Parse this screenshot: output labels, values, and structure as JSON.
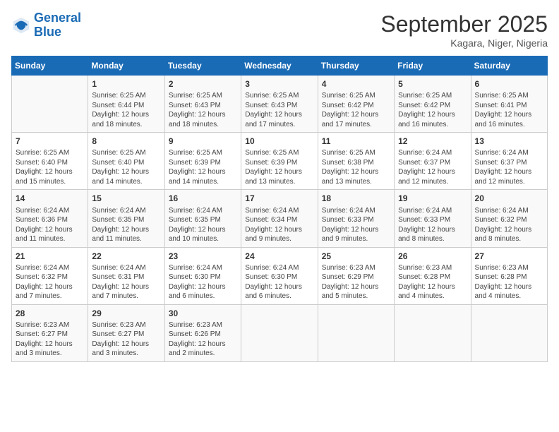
{
  "logo": {
    "line1": "General",
    "line2": "Blue"
  },
  "title": "September 2025",
  "subtitle": "Kagara, Niger, Nigeria",
  "days_of_week": [
    "Sunday",
    "Monday",
    "Tuesday",
    "Wednesday",
    "Thursday",
    "Friday",
    "Saturday"
  ],
  "weeks": [
    [
      {
        "day": "",
        "info": ""
      },
      {
        "day": "1",
        "info": "Sunrise: 6:25 AM\nSunset: 6:44 PM\nDaylight: 12 hours\nand 18 minutes."
      },
      {
        "day": "2",
        "info": "Sunrise: 6:25 AM\nSunset: 6:43 PM\nDaylight: 12 hours\nand 18 minutes."
      },
      {
        "day": "3",
        "info": "Sunrise: 6:25 AM\nSunset: 6:43 PM\nDaylight: 12 hours\nand 17 minutes."
      },
      {
        "day": "4",
        "info": "Sunrise: 6:25 AM\nSunset: 6:42 PM\nDaylight: 12 hours\nand 17 minutes."
      },
      {
        "day": "5",
        "info": "Sunrise: 6:25 AM\nSunset: 6:42 PM\nDaylight: 12 hours\nand 16 minutes."
      },
      {
        "day": "6",
        "info": "Sunrise: 6:25 AM\nSunset: 6:41 PM\nDaylight: 12 hours\nand 16 minutes."
      }
    ],
    [
      {
        "day": "7",
        "info": "Sunrise: 6:25 AM\nSunset: 6:40 PM\nDaylight: 12 hours\nand 15 minutes."
      },
      {
        "day": "8",
        "info": "Sunrise: 6:25 AM\nSunset: 6:40 PM\nDaylight: 12 hours\nand 14 minutes."
      },
      {
        "day": "9",
        "info": "Sunrise: 6:25 AM\nSunset: 6:39 PM\nDaylight: 12 hours\nand 14 minutes."
      },
      {
        "day": "10",
        "info": "Sunrise: 6:25 AM\nSunset: 6:39 PM\nDaylight: 12 hours\nand 13 minutes."
      },
      {
        "day": "11",
        "info": "Sunrise: 6:25 AM\nSunset: 6:38 PM\nDaylight: 12 hours\nand 13 minutes."
      },
      {
        "day": "12",
        "info": "Sunrise: 6:24 AM\nSunset: 6:37 PM\nDaylight: 12 hours\nand 12 minutes."
      },
      {
        "day": "13",
        "info": "Sunrise: 6:24 AM\nSunset: 6:37 PM\nDaylight: 12 hours\nand 12 minutes."
      }
    ],
    [
      {
        "day": "14",
        "info": "Sunrise: 6:24 AM\nSunset: 6:36 PM\nDaylight: 12 hours\nand 11 minutes."
      },
      {
        "day": "15",
        "info": "Sunrise: 6:24 AM\nSunset: 6:35 PM\nDaylight: 12 hours\nand 11 minutes."
      },
      {
        "day": "16",
        "info": "Sunrise: 6:24 AM\nSunset: 6:35 PM\nDaylight: 12 hours\nand 10 minutes."
      },
      {
        "day": "17",
        "info": "Sunrise: 6:24 AM\nSunset: 6:34 PM\nDaylight: 12 hours\nand 9 minutes."
      },
      {
        "day": "18",
        "info": "Sunrise: 6:24 AM\nSunset: 6:33 PM\nDaylight: 12 hours\nand 9 minutes."
      },
      {
        "day": "19",
        "info": "Sunrise: 6:24 AM\nSunset: 6:33 PM\nDaylight: 12 hours\nand 8 minutes."
      },
      {
        "day": "20",
        "info": "Sunrise: 6:24 AM\nSunset: 6:32 PM\nDaylight: 12 hours\nand 8 minutes."
      }
    ],
    [
      {
        "day": "21",
        "info": "Sunrise: 6:24 AM\nSunset: 6:32 PM\nDaylight: 12 hours\nand 7 minutes."
      },
      {
        "day": "22",
        "info": "Sunrise: 6:24 AM\nSunset: 6:31 PM\nDaylight: 12 hours\nand 7 minutes."
      },
      {
        "day": "23",
        "info": "Sunrise: 6:24 AM\nSunset: 6:30 PM\nDaylight: 12 hours\nand 6 minutes."
      },
      {
        "day": "24",
        "info": "Sunrise: 6:24 AM\nSunset: 6:30 PM\nDaylight: 12 hours\nand 6 minutes."
      },
      {
        "day": "25",
        "info": "Sunrise: 6:23 AM\nSunset: 6:29 PM\nDaylight: 12 hours\nand 5 minutes."
      },
      {
        "day": "26",
        "info": "Sunrise: 6:23 AM\nSunset: 6:28 PM\nDaylight: 12 hours\nand 4 minutes."
      },
      {
        "day": "27",
        "info": "Sunrise: 6:23 AM\nSunset: 6:28 PM\nDaylight: 12 hours\nand 4 minutes."
      }
    ],
    [
      {
        "day": "28",
        "info": "Sunrise: 6:23 AM\nSunset: 6:27 PM\nDaylight: 12 hours\nand 3 minutes."
      },
      {
        "day": "29",
        "info": "Sunrise: 6:23 AM\nSunset: 6:27 PM\nDaylight: 12 hours\nand 3 minutes."
      },
      {
        "day": "30",
        "info": "Sunrise: 6:23 AM\nSunset: 6:26 PM\nDaylight: 12 hours\nand 2 minutes."
      },
      {
        "day": "",
        "info": ""
      },
      {
        "day": "",
        "info": ""
      },
      {
        "day": "",
        "info": ""
      },
      {
        "day": "",
        "info": ""
      }
    ]
  ]
}
